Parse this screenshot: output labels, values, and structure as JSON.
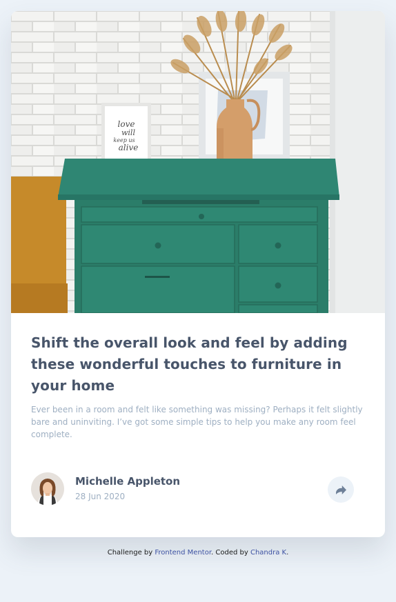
{
  "article": {
    "title": "Shift the overall look and feel by adding these wonderful touches to furniture in your home",
    "excerpt": "Ever been in a room and felt like something was missing? Perhaps it felt slightly bare and uninviting. I’ve got some simple tips to help you make any room feel complete.",
    "image": {
      "frame_text": [
        "love",
        "will",
        "keep us",
        "alive"
      ]
    }
  },
  "author": {
    "name": "Michelle Appleton",
    "date": "28 Jun 2020"
  },
  "share": {
    "icon": "share-icon"
  },
  "footer": {
    "prefix": "Challenge by ",
    "challenge_link": "Frontend Mentor",
    "middle": ". Coded by ",
    "coder_link": "Chandra K",
    "suffix": "."
  },
  "colors": {
    "heading": "#48556a",
    "body": "#9eafc2",
    "background": "#ecf2f8",
    "link": "#3e52a3",
    "dresser": "#2f7e6b"
  }
}
